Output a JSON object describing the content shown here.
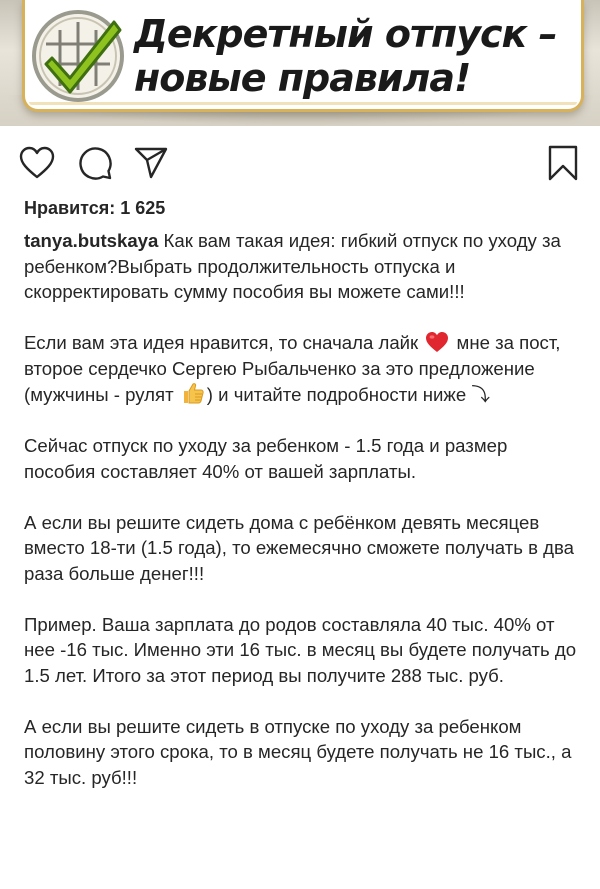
{
  "banner": {
    "title_line1": "Декретный отпуск –",
    "title_line2": "новые правила!",
    "colors": {
      "accent_gold": "#d8b25a",
      "check_green": "#8dc21f"
    }
  },
  "actions": {
    "like_icon": "heart-icon",
    "comment_icon": "comment-icon",
    "share_icon": "send-icon",
    "save_icon": "bookmark-icon"
  },
  "likes": {
    "text": "Нравится: 1 625"
  },
  "caption": {
    "username": "tanya.butskaya",
    "p1_text": "Как вам такая идея: гибкий отпуск по уходу за ребенком?Выбрать продолжительность отпуска и скорректировать сумму пособия вы можете сами!!!",
    "p2_part1": "Если вам эта идея нравится, то сначала лайк",
    "p2_heart_emoji": "red-heart-emoji",
    "p2_part2": "мне за пост, второе сердечко Сергею Рыбальченко за это предложение (мужчины - рулят",
    "p2_thumb_emoji": "thumbs-up-emoji",
    "p2_part3": ") и читайте подробности ниже ⤵",
    "p3": "Сейчас отпуск по уходу за ребенком - 1.5 года и размер пособия составляет 40% от вашей зарплаты.",
    "p4": "А если вы решите сидеть дома с ребёнком девять месяцев вместо 18-ти (1.5 года), то ежемесячно сможете получать в два раза больше денег!!!",
    "p5": "Пример. Ваша зарплата до родов составляла 40 тыс. 40% от нее -16 тыс. Именно эти 16 тыс. в месяц вы будете получать до 1.5 лет. Итого за этот период вы получите 288 тыс. руб.",
    "p6": "А если вы решите сидеть в отпуске по уходу за ребенком половину этого срока, то в месяц будете получать не 16 тыс., а 32 тыс. руб!!!"
  }
}
